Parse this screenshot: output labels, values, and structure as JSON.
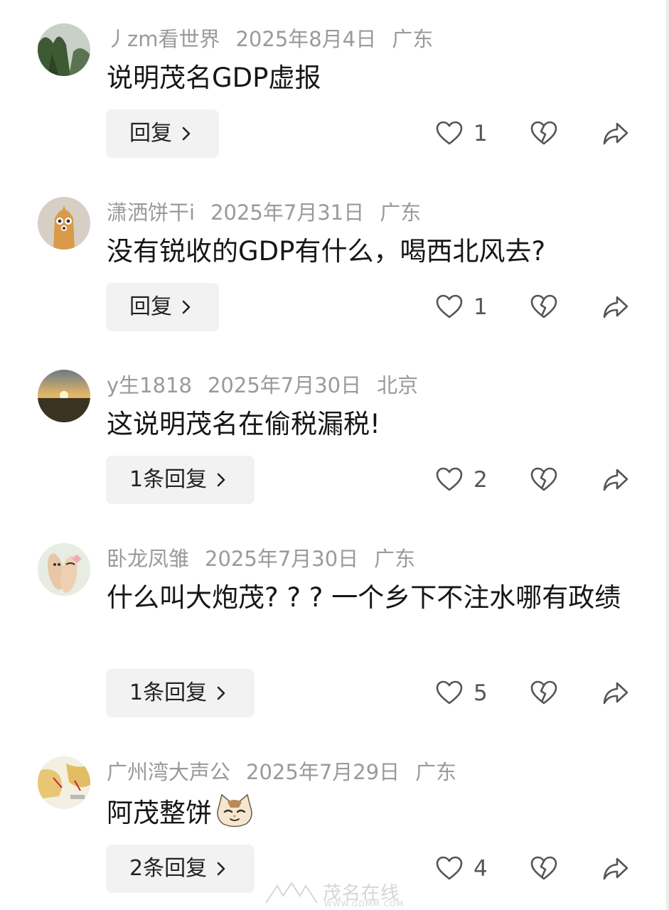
{
  "comments": [
    {
      "username": "丿zm看世界",
      "date": "2025年8月4日",
      "location": "广东",
      "text": "说明茂名GDP虚报",
      "reply_label": "回复",
      "likes": "1",
      "avatar": "forest-mountain-avatar"
    },
    {
      "username": "潇洒饼干i",
      "date": "2025年7月31日",
      "location": "广东",
      "text": "没有锐收的GDP有什么，喝西北风去?",
      "reply_label": "回复",
      "likes": "1",
      "avatar": "cartoon-figure-avatar"
    },
    {
      "username": "y生1818",
      "date": "2025年7月30日",
      "location": "北京",
      "text": "这说明茂名在偷税漏税!",
      "reply_label": "1条回复",
      "likes": "2",
      "avatar": "sunset-avatar"
    },
    {
      "username": "卧龙凤雏",
      "date": "2025年7月30日",
      "location": "广东",
      "text": "什么叫大炮茂? ? ? 一个乡下不注水哪有政绩",
      "reply_label": "1条回复",
      "likes": "5",
      "avatar": "fingers-avatar"
    },
    {
      "username": "广州湾大声公",
      "date": "2025年7月29日",
      "location": "广东",
      "text": "阿茂整饼",
      "emoji": "cat-face-emoji",
      "reply_label": "2条回复",
      "likes": "4",
      "avatar": "map-avatar"
    }
  ],
  "watermark": {
    "main": "茂名在线",
    "sub": "WWW.GDMM.COM"
  },
  "colors": {
    "meta_gray": "#9a9a9a",
    "text": "#161616",
    "button_bg": "#f2f2f2",
    "icon": "#555555"
  }
}
